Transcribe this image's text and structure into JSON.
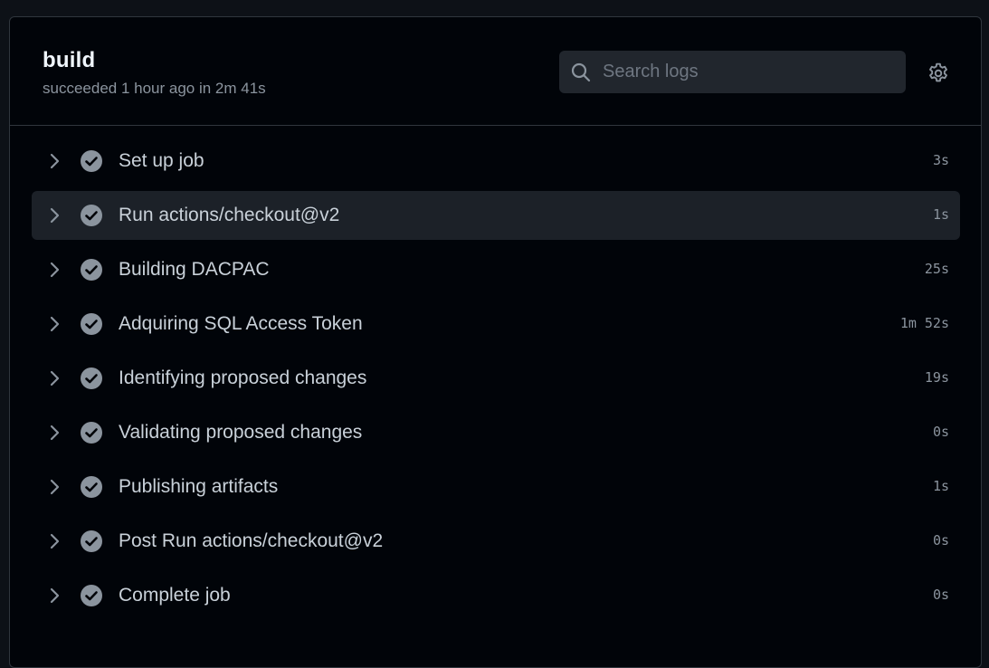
{
  "job": {
    "title": "build",
    "meta": "succeeded 1 hour ago in 2m 41s"
  },
  "search": {
    "placeholder": "Search logs",
    "value": ""
  },
  "icons": {
    "search": "search-icon",
    "settings": "gear-icon",
    "expand": "chevron-right-icon",
    "status": "check-circle-icon"
  },
  "colors": {
    "panel_bg": "#010409",
    "hover_row": "#1c2128",
    "check": "#8b949e"
  },
  "steps": [
    {
      "label": "Set up job",
      "duration": "3s"
    },
    {
      "label": "Run actions/checkout@v2",
      "duration": "1s",
      "highlighted": true
    },
    {
      "label": "Building DACPAC",
      "duration": "25s"
    },
    {
      "label": "Adquiring SQL Access Token",
      "duration": "1m 52s"
    },
    {
      "label": "Identifying proposed changes",
      "duration": "19s"
    },
    {
      "label": "Validating proposed changes",
      "duration": "0s"
    },
    {
      "label": "Publishing artifacts",
      "duration": "1s"
    },
    {
      "label": "Post Run actions/checkout@v2",
      "duration": "0s"
    },
    {
      "label": "Complete job",
      "duration": "0s"
    }
  ]
}
